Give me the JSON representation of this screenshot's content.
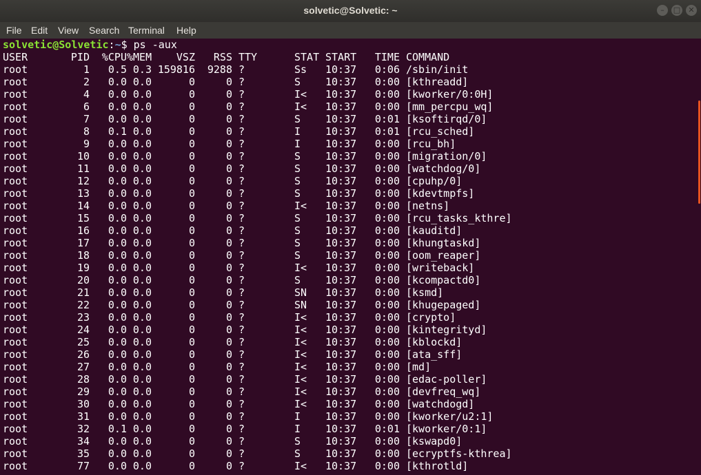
{
  "window": {
    "title": "solvetic@Solvetic: ~",
    "buttons": {
      "minimize": "–",
      "maximize": "□",
      "close": "✕"
    }
  },
  "menu": [
    "File",
    "Edit",
    "View",
    "Search",
    "Terminal",
    "Help"
  ],
  "prompt": {
    "user_host": "solvetic@Solvetic",
    "sep": ":",
    "path": "~",
    "symbol": "$",
    "command": "ps -aux"
  },
  "headers": [
    "USER",
    "PID",
    "%CPU",
    "%MEM",
    "VSZ",
    "RSS",
    "TTY",
    "STAT",
    "START",
    "TIME",
    "COMMAND"
  ],
  "rows": [
    [
      "root",
      "1",
      "0.5",
      "0.3",
      "159816",
      "9288",
      "?",
      "Ss",
      "10:37",
      "0:06",
      "/sbin/init"
    ],
    [
      "root",
      "2",
      "0.0",
      "0.0",
      "0",
      "0",
      "?",
      "S",
      "10:37",
      "0:00",
      "[kthreadd]"
    ],
    [
      "root",
      "4",
      "0.0",
      "0.0",
      "0",
      "0",
      "?",
      "I<",
      "10:37",
      "0:00",
      "[kworker/0:0H]"
    ],
    [
      "root",
      "6",
      "0.0",
      "0.0",
      "0",
      "0",
      "?",
      "I<",
      "10:37",
      "0:00",
      "[mm_percpu_wq]"
    ],
    [
      "root",
      "7",
      "0.0",
      "0.0",
      "0",
      "0",
      "?",
      "S",
      "10:37",
      "0:01",
      "[ksoftirqd/0]"
    ],
    [
      "root",
      "8",
      "0.1",
      "0.0",
      "0",
      "0",
      "?",
      "I",
      "10:37",
      "0:01",
      "[rcu_sched]"
    ],
    [
      "root",
      "9",
      "0.0",
      "0.0",
      "0",
      "0",
      "?",
      "I",
      "10:37",
      "0:00",
      "[rcu_bh]"
    ],
    [
      "root",
      "10",
      "0.0",
      "0.0",
      "0",
      "0",
      "?",
      "S",
      "10:37",
      "0:00",
      "[migration/0]"
    ],
    [
      "root",
      "11",
      "0.0",
      "0.0",
      "0",
      "0",
      "?",
      "S",
      "10:37",
      "0:00",
      "[watchdog/0]"
    ],
    [
      "root",
      "12",
      "0.0",
      "0.0",
      "0",
      "0",
      "?",
      "S",
      "10:37",
      "0:00",
      "[cpuhp/0]"
    ],
    [
      "root",
      "13",
      "0.0",
      "0.0",
      "0",
      "0",
      "?",
      "S",
      "10:37",
      "0:00",
      "[kdevtmpfs]"
    ],
    [
      "root",
      "14",
      "0.0",
      "0.0",
      "0",
      "0",
      "?",
      "I<",
      "10:37",
      "0:00",
      "[netns]"
    ],
    [
      "root",
      "15",
      "0.0",
      "0.0",
      "0",
      "0",
      "?",
      "S",
      "10:37",
      "0:00",
      "[rcu_tasks_kthre]"
    ],
    [
      "root",
      "16",
      "0.0",
      "0.0",
      "0",
      "0",
      "?",
      "S",
      "10:37",
      "0:00",
      "[kauditd]"
    ],
    [
      "root",
      "17",
      "0.0",
      "0.0",
      "0",
      "0",
      "?",
      "S",
      "10:37",
      "0:00",
      "[khungtaskd]"
    ],
    [
      "root",
      "18",
      "0.0",
      "0.0",
      "0",
      "0",
      "?",
      "S",
      "10:37",
      "0:00",
      "[oom_reaper]"
    ],
    [
      "root",
      "19",
      "0.0",
      "0.0",
      "0",
      "0",
      "?",
      "I<",
      "10:37",
      "0:00",
      "[writeback]"
    ],
    [
      "root",
      "20",
      "0.0",
      "0.0",
      "0",
      "0",
      "?",
      "S",
      "10:37",
      "0:00",
      "[kcompactd0]"
    ],
    [
      "root",
      "21",
      "0.0",
      "0.0",
      "0",
      "0",
      "?",
      "SN",
      "10:37",
      "0:00",
      "[ksmd]"
    ],
    [
      "root",
      "22",
      "0.0",
      "0.0",
      "0",
      "0",
      "?",
      "SN",
      "10:37",
      "0:00",
      "[khugepaged]"
    ],
    [
      "root",
      "23",
      "0.0",
      "0.0",
      "0",
      "0",
      "?",
      "I<",
      "10:37",
      "0:00",
      "[crypto]"
    ],
    [
      "root",
      "24",
      "0.0",
      "0.0",
      "0",
      "0",
      "?",
      "I<",
      "10:37",
      "0:00",
      "[kintegrityd]"
    ],
    [
      "root",
      "25",
      "0.0",
      "0.0",
      "0",
      "0",
      "?",
      "I<",
      "10:37",
      "0:00",
      "[kblockd]"
    ],
    [
      "root",
      "26",
      "0.0",
      "0.0",
      "0",
      "0",
      "?",
      "I<",
      "10:37",
      "0:00",
      "[ata_sff]"
    ],
    [
      "root",
      "27",
      "0.0",
      "0.0",
      "0",
      "0",
      "?",
      "I<",
      "10:37",
      "0:00",
      "[md]"
    ],
    [
      "root",
      "28",
      "0.0",
      "0.0",
      "0",
      "0",
      "?",
      "I<",
      "10:37",
      "0:00",
      "[edac-poller]"
    ],
    [
      "root",
      "29",
      "0.0",
      "0.0",
      "0",
      "0",
      "?",
      "I<",
      "10:37",
      "0:00",
      "[devfreq_wq]"
    ],
    [
      "root",
      "30",
      "0.0",
      "0.0",
      "0",
      "0",
      "?",
      "I<",
      "10:37",
      "0:00",
      "[watchdogd]"
    ],
    [
      "root",
      "31",
      "0.0",
      "0.0",
      "0",
      "0",
      "?",
      "I",
      "10:37",
      "0:00",
      "[kworker/u2:1]"
    ],
    [
      "root",
      "32",
      "0.1",
      "0.0",
      "0",
      "0",
      "?",
      "I",
      "10:37",
      "0:01",
      "[kworker/0:1]"
    ],
    [
      "root",
      "34",
      "0.0",
      "0.0",
      "0",
      "0",
      "?",
      "S",
      "10:37",
      "0:00",
      "[kswapd0]"
    ],
    [
      "root",
      "35",
      "0.0",
      "0.0",
      "0",
      "0",
      "?",
      "S",
      "10:37",
      "0:00",
      "[ecryptfs-kthrea]"
    ],
    [
      "root",
      "77",
      "0.0",
      "0.0",
      "0",
      "0",
      "?",
      "I<",
      "10:37",
      "0:00",
      "[kthrotld]"
    ]
  ],
  "colors": {
    "background": "#300a24",
    "prompt_user": "#8ae234",
    "prompt_path": "#729fcf",
    "text": "#ffffff",
    "scrollbar_thumb": "#e95420"
  }
}
